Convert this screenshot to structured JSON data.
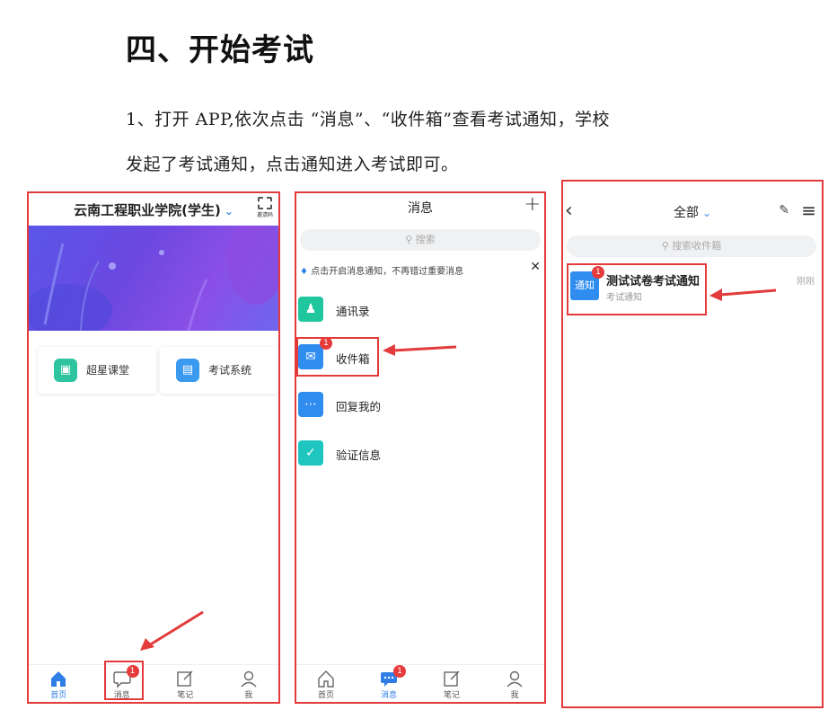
{
  "doc": {
    "heading": "四、开始考试",
    "para_line1": "1、打开 APP,依次点击 “消息”、“收件箱”查看考试通知，学校",
    "para_line2": "发起了考试通知，点击通知进入考试即可。"
  },
  "screen1": {
    "title": "云南工程职业学院(学生)",
    "qr_label": "邀请码",
    "cards": [
      {
        "label": "超星课堂",
        "icon": "presentation-icon",
        "color": "#2ec4a0"
      },
      {
        "label": "考试系统",
        "icon": "exam-icon",
        "color": "#3a9af0"
      }
    ],
    "tabs": [
      {
        "label": "首页",
        "icon": "home-icon"
      },
      {
        "label": "消息",
        "icon": "chat-bubble-icon",
        "badge": "1"
      },
      {
        "label": "笔记",
        "icon": "note-icon"
      },
      {
        "label": "我",
        "icon": "person-icon"
      }
    ]
  },
  "screen2": {
    "title": "消息",
    "search_placeholder": "搜索",
    "notice": "点击开启消息通知，不再错过重要消息",
    "rows": [
      {
        "label": "通讯录",
        "icon": "contacts-icon",
        "color": "#1fc69e"
      },
      {
        "label": "收件箱",
        "icon": "inbox-icon",
        "color": "#2f8df0",
        "badge": "1"
      },
      {
        "label": "回复我的",
        "icon": "reply-bubble-icon",
        "color": "#2f8df0"
      },
      {
        "label": "验证信息",
        "icon": "shield-check-icon",
        "color": "#1fc6c0"
      }
    ],
    "tabs": [
      {
        "label": "首页",
        "icon": "home-icon"
      },
      {
        "label": "消息",
        "icon": "chat-bubble-icon",
        "badge": "1"
      },
      {
        "label": "笔记",
        "icon": "note-icon"
      },
      {
        "label": "我",
        "icon": "person-icon"
      }
    ]
  },
  "screen3": {
    "title": "全部",
    "search_placeholder": "搜索收件箱",
    "item": {
      "icon_text": "通知",
      "badge": "1",
      "title": "测试试卷考试通知",
      "subtitle": "考试通知",
      "time": "刚刚"
    }
  },
  "colors": {
    "accent": "#2f7ee8",
    "highlight_box": "#e33b3b",
    "badge": "#e73a3a"
  }
}
